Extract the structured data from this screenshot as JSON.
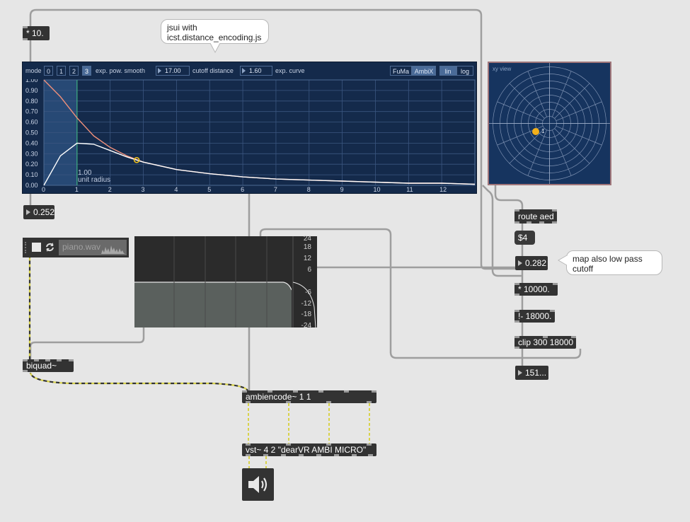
{
  "objects": {
    "times10": "* 10.",
    "route": "route aed",
    "dollar4": "$4",
    "times10000": "* 10000.",
    "rminus": "!- 18000.",
    "clip": "clip 300 18000",
    "biquad": "biquad~",
    "ambiencode": "ambiencode~ 1 1",
    "vst": "vst~ 4 2 \"dearVR AMBI MICRO\""
  },
  "numbers": {
    "left_out": "0.252",
    "route_val": "0.282",
    "freq_out": "151..."
  },
  "comments": {
    "jsui_note_line1": "jsui with",
    "jsui_note_line2": "icst.distance_encoding.js",
    "map_note_line1": "map also low pass",
    "map_note_line2": "cutoff"
  },
  "jsui": {
    "mode_label": "mode",
    "modes": [
      "0",
      "1",
      "2",
      "3"
    ],
    "active_mode": "3",
    "mode_name": "exp. pow. smooth",
    "cutoff_value": "17.00",
    "cutoff_label": "cutoff distance",
    "curve_value": "1.60",
    "curve_label": "exp. curve",
    "norm_options": [
      "FuMa",
      "AmbiX"
    ],
    "active_norm": "AmbiX",
    "scale_options": [
      "lin",
      "log"
    ],
    "active_scale": "lin",
    "unit_radius_value": "1.00",
    "unit_radius_label": "unit radius",
    "colors": {
      "bg": "#142a4b",
      "curve_gain": "#f0907a",
      "curve_energy": "#ffffff",
      "marker": "#f2c21b"
    }
  },
  "chart_data": {
    "type": "line",
    "x": [
      0,
      0.5,
      1,
      1.5,
      2,
      2.5,
      3,
      4,
      5,
      6,
      7,
      8,
      9,
      10,
      11,
      12,
      13
    ],
    "series": [
      {
        "values": [
          1.0,
          0.84,
          0.64,
          0.47,
          0.36,
          0.28,
          0.22,
          0.15,
          0.11,
          0.08,
          0.06,
          0.05,
          0.04,
          0.03,
          0.02,
          0.02,
          0.01
        ]
      },
      {
        "values": [
          0.0,
          0.28,
          0.4,
          0.39,
          0.33,
          0.27,
          0.22,
          0.15,
          0.11,
          0.08,
          0.06,
          0.05,
          0.04,
          0.03,
          0.02,
          0.02,
          0.01
        ]
      }
    ],
    "marker": {
      "x": 2.8,
      "y": 0.24
    },
    "unit_radius_x": 1,
    "xlim": [
      0,
      13
    ],
    "ylim": [
      0,
      1
    ],
    "x_ticks": [
      "0",
      "1",
      "2",
      "3",
      "4",
      "5",
      "6",
      "7",
      "8",
      "9",
      "10",
      "11",
      "12"
    ],
    "y_ticks": [
      "0.00",
      "0.10",
      "0.20",
      "0.30",
      "0.40",
      "0.50",
      "0.60",
      "0.70",
      "0.80",
      "0.90",
      "1.00"
    ],
    "grid": true
  },
  "xyview": {
    "label": "xy view",
    "point_label": "1",
    "point_color": "#f2b01b"
  },
  "player": {
    "filename": "piano.wav"
  },
  "filter": {
    "ticks": [
      "24",
      "18",
      "12",
      "6",
      "-6",
      "-12",
      "-18",
      "-24"
    ]
  }
}
